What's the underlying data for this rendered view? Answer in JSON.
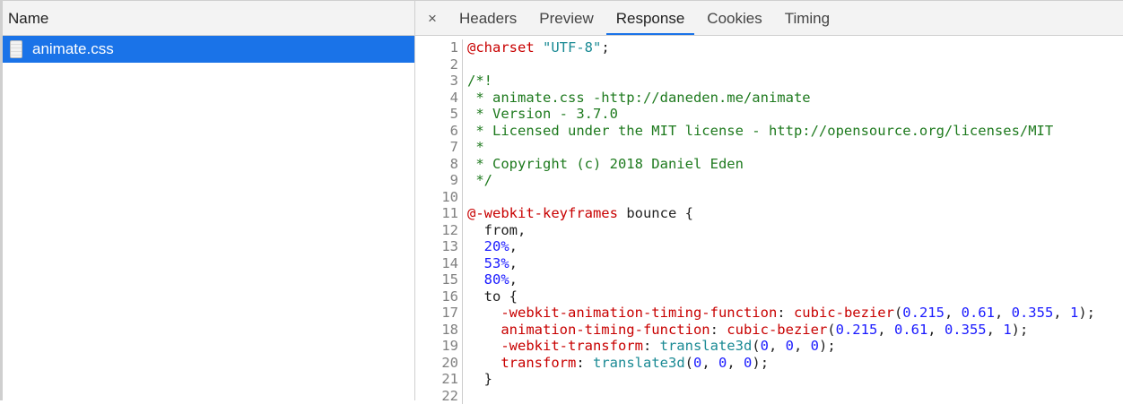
{
  "left": {
    "header": "Name",
    "file": "animate.css"
  },
  "tabs": [
    "Headers",
    "Preview",
    "Response",
    "Cookies",
    "Timing"
  ],
  "active_tab": 2,
  "close_label": "×",
  "code": [
    [
      [
        "@charset",
        "red"
      ],
      [
        " ",
        "blk"
      ],
      [
        "\"UTF-8\"",
        "teal"
      ],
      [
        ";",
        "blk"
      ]
    ],
    [],
    [
      [
        "/*!",
        "green"
      ]
    ],
    [
      [
        " * animate.css -http://daneden.me/animate",
        "green"
      ]
    ],
    [
      [
        " * Version - 3.7.0",
        "green"
      ]
    ],
    [
      [
        " * Licensed under the MIT license - http://opensource.org/licenses/MIT",
        "green"
      ]
    ],
    [
      [
        " *",
        "green"
      ]
    ],
    [
      [
        " * Copyright (c) 2018 Daniel Eden",
        "green"
      ]
    ],
    [
      [
        " */",
        "green"
      ]
    ],
    [],
    [
      [
        "@-webkit-keyframes",
        "red"
      ],
      [
        " bounce {",
        "blk"
      ]
    ],
    [
      [
        "  from,",
        "blk"
      ]
    ],
    [
      [
        "  ",
        "blk"
      ],
      [
        "20%",
        "blue"
      ],
      [
        ",",
        "blk"
      ]
    ],
    [
      [
        "  ",
        "blk"
      ],
      [
        "53%",
        "blue"
      ],
      [
        ",",
        "blk"
      ]
    ],
    [
      [
        "  ",
        "blk"
      ],
      [
        "80%",
        "blue"
      ],
      [
        ",",
        "blk"
      ]
    ],
    [
      [
        "  to {",
        "blk"
      ]
    ],
    [
      [
        "    ",
        "blk"
      ],
      [
        "-webkit-animation-timing-function",
        "red"
      ],
      [
        ": ",
        "blk"
      ],
      [
        "cubic-bezier",
        "red"
      ],
      [
        "(",
        "blk"
      ],
      [
        "0.215",
        "blue"
      ],
      [
        ", ",
        "blk"
      ],
      [
        "0.61",
        "blue"
      ],
      [
        ", ",
        "blk"
      ],
      [
        "0.355",
        "blue"
      ],
      [
        ", ",
        "blk"
      ],
      [
        "1",
        "blue"
      ],
      [
        ");",
        "blk"
      ]
    ],
    [
      [
        "    ",
        "blk"
      ],
      [
        "animation-timing-function",
        "red"
      ],
      [
        ": ",
        "blk"
      ],
      [
        "cubic-bezier",
        "red"
      ],
      [
        "(",
        "blk"
      ],
      [
        "0.215",
        "blue"
      ],
      [
        ", ",
        "blk"
      ],
      [
        "0.61",
        "blue"
      ],
      [
        ", ",
        "blk"
      ],
      [
        "0.355",
        "blue"
      ],
      [
        ", ",
        "blk"
      ],
      [
        "1",
        "blue"
      ],
      [
        ");",
        "blk"
      ]
    ],
    [
      [
        "    ",
        "blk"
      ],
      [
        "-webkit-transform",
        "red"
      ],
      [
        ": ",
        "blk"
      ],
      [
        "translate3d",
        "teal"
      ],
      [
        "(",
        "blk"
      ],
      [
        "0",
        "blue"
      ],
      [
        ", ",
        "blk"
      ],
      [
        "0",
        "blue"
      ],
      [
        ", ",
        "blk"
      ],
      [
        "0",
        "blue"
      ],
      [
        ");",
        "blk"
      ]
    ],
    [
      [
        "    ",
        "blk"
      ],
      [
        "transform",
        "red"
      ],
      [
        ": ",
        "blk"
      ],
      [
        "translate3d",
        "teal"
      ],
      [
        "(",
        "blk"
      ],
      [
        "0",
        "blue"
      ],
      [
        ", ",
        "blk"
      ],
      [
        "0",
        "blue"
      ],
      [
        ", ",
        "blk"
      ],
      [
        "0",
        "blue"
      ],
      [
        ");",
        "blk"
      ]
    ],
    [
      [
        "  }",
        "blk"
      ]
    ],
    []
  ]
}
